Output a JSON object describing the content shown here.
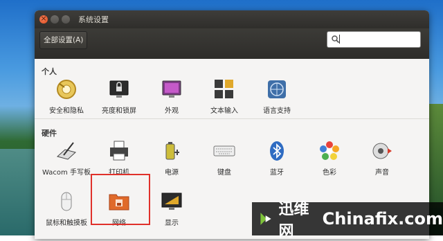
{
  "window": {
    "title": "系统设置"
  },
  "toolbar": {
    "all_settings_label": "全部设置(A)",
    "search_value": ""
  },
  "sections": {
    "personal": {
      "title": "个人",
      "items": [
        "安全和隐私",
        "亮度和锁屏",
        "外观",
        "文本输入",
        "语言支持"
      ]
    },
    "hardware": {
      "title": "硬件",
      "items": [
        "Wacom 手写板",
        "打印机",
        "电源",
        "键盘",
        "蓝牙",
        "色彩",
        "声音",
        "鼠标和触摸板",
        "网络",
        "显示"
      ]
    }
  },
  "watermark": {
    "brand": "迅维网",
    "site": "Chinafix.com"
  },
  "colors": {
    "accent_highlight": "#e0302a",
    "titlebar": "#3c3b37",
    "close": "#e1491d"
  }
}
